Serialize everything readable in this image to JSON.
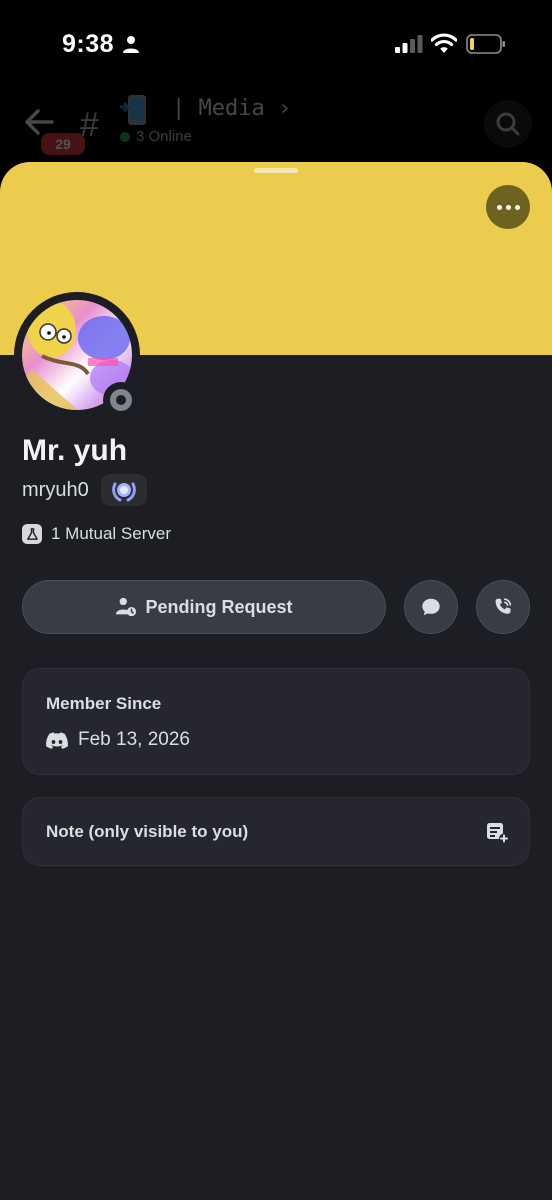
{
  "status_bar": {
    "time": "9:38"
  },
  "channel_header": {
    "unread_count": "29",
    "channel_name": "| Media",
    "online": "3 Online"
  },
  "profile": {
    "banner_color": "#eccc4c",
    "display_name": "Mr. yuh",
    "username": "mryuh0",
    "mutual": "1 Mutual Server",
    "pending_label": "Pending Request",
    "member_since_title": "Member Since",
    "member_since_date": "Feb 13, 2026",
    "note_label": "Note (only visible to you)"
  },
  "colors": {
    "background": "#1d1e23",
    "card": "#26272e",
    "button": "#393c44",
    "online": "#23a559",
    "badge_red": "#d83c3e"
  },
  "icons": [
    "person-icon",
    "signal-icon",
    "wifi-icon",
    "battery-icon",
    "back-arrow-icon",
    "hash-icon",
    "search-icon",
    "more-icon",
    "add-friend-pending-icon",
    "message-icon",
    "phone-icon",
    "discord-icon",
    "note-add-icon"
  ]
}
